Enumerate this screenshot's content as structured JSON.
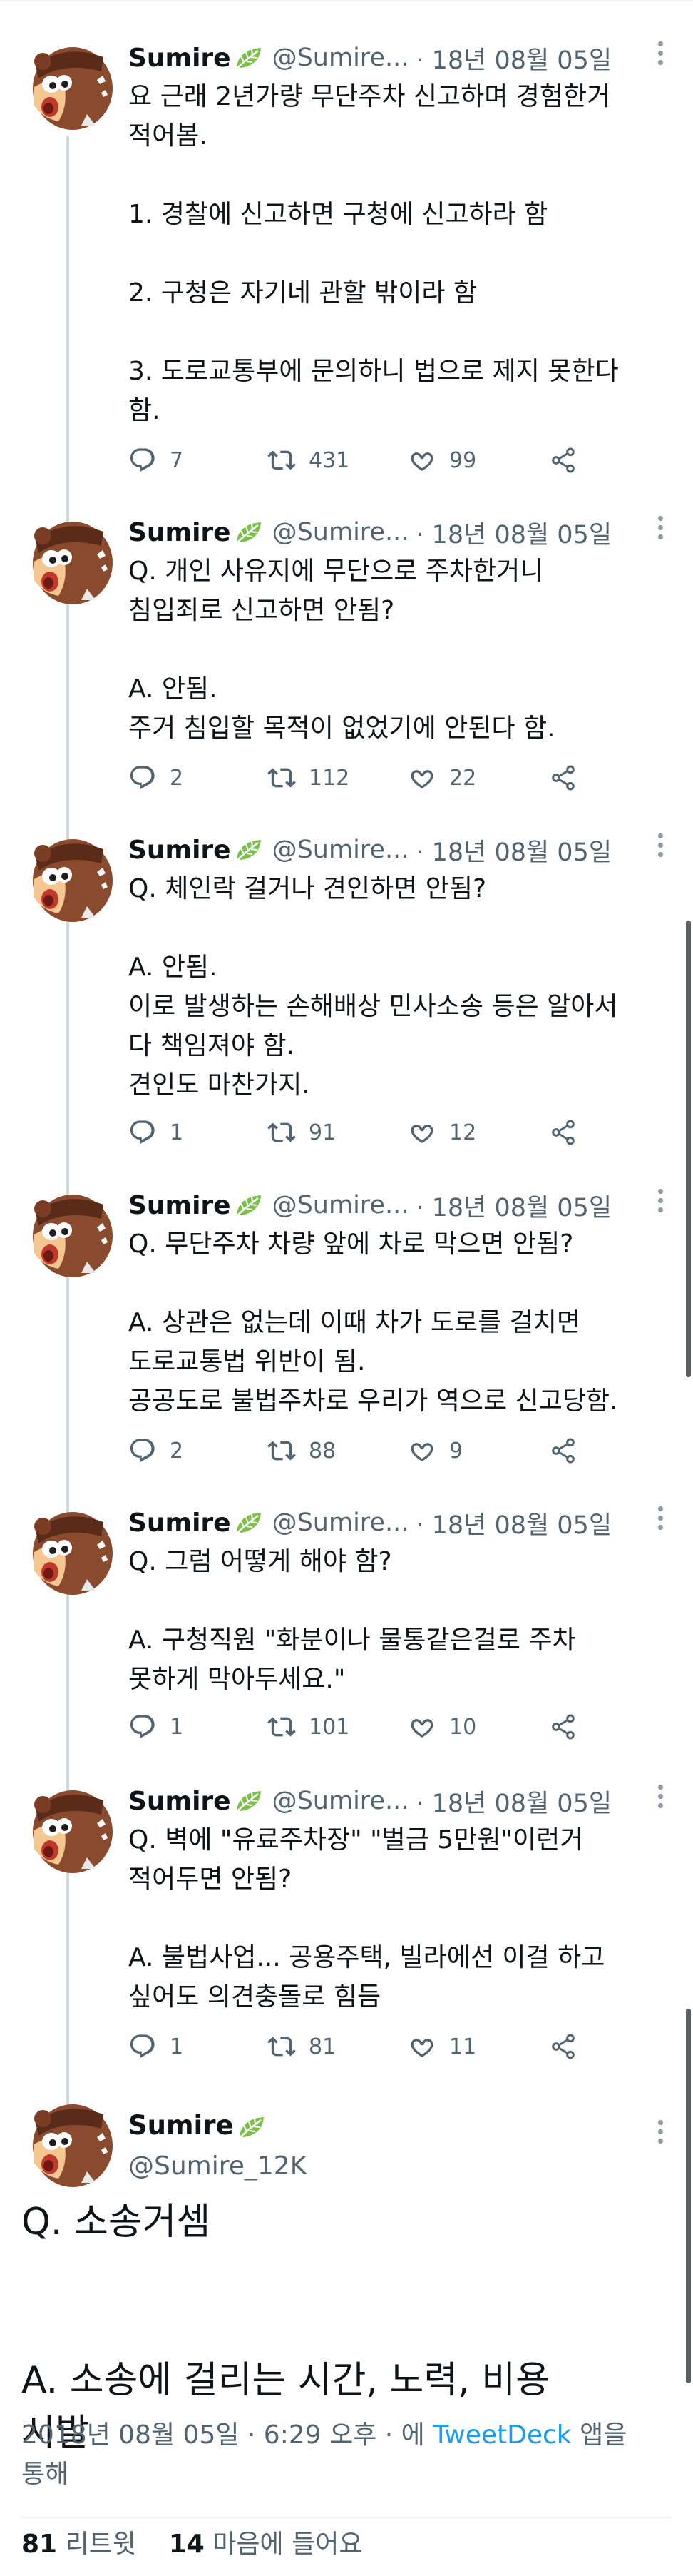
{
  "tweets": [
    {
      "name": "Sumire",
      "handle": "@Sumire...",
      "date": "· 18년 08월 05일",
      "text": "요 근래 2년가량 무단주차 신고하며 경험한거\n적어봄.\n\n1. 경찰에 신고하면 구청에 신고하라 함\n\n2. 구청은 자기네 관할 밖이라 함\n\n3. 도로교통부에 문의하니 법으로 제지 못한다\n함.",
      "replies": "7",
      "retweets": "431",
      "likes": "99"
    },
    {
      "name": "Sumire",
      "handle": "@Sumire...",
      "date": "· 18년 08월 05일",
      "text": "Q. 개인 사유지에 무단으로 주차한거니\n침입죄로 신고하면 안됨?\n\nA. 안됨.\n주거 침입할 목적이 없었기에 안된다 함.",
      "replies": "2",
      "retweets": "112",
      "likes": "22"
    },
    {
      "name": "Sumire",
      "handle": "@Sumire...",
      "date": "· 18년 08월 05일",
      "text": "Q. 체인락 걸거나 견인하면 안됨?\n\nA. 안됨.\n이로 발생하는 손해배상 민사소송 등은 알아서\n다 책임져야 함.\n견인도 마찬가지.",
      "replies": "1",
      "retweets": "91",
      "likes": "12"
    },
    {
      "name": "Sumire",
      "handle": "@Sumire...",
      "date": "· 18년 08월 05일",
      "text": "Q. 무단주차 차량 앞에 차로 막으면 안됨?\n\nA. 상관은 없는데 이때 차가 도로를 걸치면\n도로교통법 위반이 됨.\n공공도로 불법주차로 우리가 역으로 신고당함.",
      "replies": "2",
      "retweets": "88",
      "likes": "9"
    },
    {
      "name": "Sumire",
      "handle": "@Sumire...",
      "date": "· 18년 08월 05일",
      "text": "Q. 그럼 어떻게 해야 함?\n\nA. 구청직원 \"화분이나 물통같은걸로 주차\n못하게 막아두세요.\"",
      "replies": "1",
      "retweets": "101",
      "likes": "10"
    },
    {
      "name": "Sumire",
      "handle": "@Sumire...",
      "date": "· 18년 08월 05일",
      "text": "Q. 벽에 \"유료주차장\" \"벌금 5만원\"이런거\n적어두면 안됨?\n\nA. 불법사업... 공용주택, 빌라에선 이걸 하고\n싶어도 의견충돌로 힘듬",
      "replies": "1",
      "retweets": "81",
      "likes": "11"
    }
  ],
  "main": {
    "name": "Sumire",
    "handle": "@Sumire_12K",
    "text": "Q. 소송거셈\n\n\nA. 소송에 걸리는 시간, 노력, 비용\n시발",
    "time": "2018년 08월 05일 · 6:29 오후 · 에 ",
    "via": "TweetDeck",
    "time_suffix": " 앱을\n통해",
    "retweet_count": "81",
    "retweet_label": "리트윗",
    "like_count": "14",
    "like_label": "마음에 들어요"
  },
  "icons": {
    "reply": "reply-icon",
    "retweet": "retweet-icon",
    "like": "heart-icon",
    "share": "share-icon",
    "more": "more-icon",
    "emoji": "leaf-emoji"
  },
  "colors": {
    "text": "#0f1419",
    "muted": "#536471",
    "link": "#1d9bf0",
    "thread_line": "#cfd9de",
    "leaf": "#7cc04a"
  }
}
